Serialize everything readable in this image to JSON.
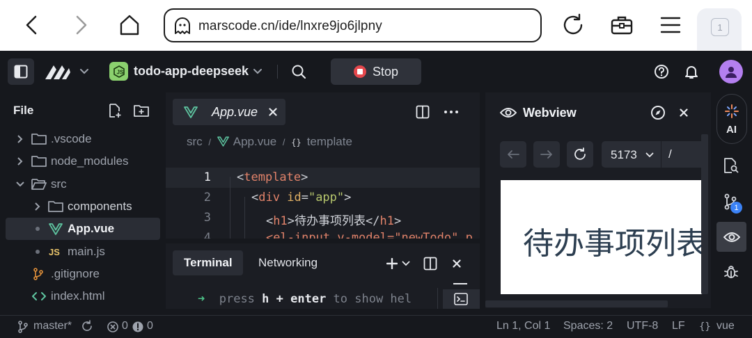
{
  "browser": {
    "url": "marscode.cn/ide/lnxre9jo6jlpny",
    "tab_count": "1"
  },
  "ide": {
    "project_name": "todo-app-deepseek",
    "stop_label": "Stop",
    "avatar_color": "#b47ff0",
    "accent_green": "#8bd16e"
  },
  "sidebar": {
    "title": "File",
    "items": [
      {
        "label": ".vscode"
      },
      {
        "label": "node_modules"
      },
      {
        "label": "src"
      },
      {
        "label": "components"
      },
      {
        "label": "App.vue"
      },
      {
        "label": "main.js"
      },
      {
        "label": ".gitignore"
      },
      {
        "label": "index.html"
      }
    ]
  },
  "editor": {
    "tab_label": "App.vue",
    "breadcrumb": {
      "part1": "src",
      "sep": "/",
      "part2": "App.vue",
      "part3": "template"
    },
    "line_numbers": [
      "1",
      "2",
      "3",
      "4"
    ],
    "lines": [
      {
        "lt": "<",
        "tag": "template",
        "gt": ">"
      },
      {
        "lt": "<",
        "tag": "div",
        "attr": "id",
        "eq": "=",
        "str": "\"app\"",
        "gt": ">"
      },
      {
        "lt": "<",
        "tag": "h1",
        "gt1": ">",
        "text": "待办事项列表",
        "lt2": "</",
        "tag2": "h1",
        "gt2": ">"
      },
      {
        "text": "<el-input v-model=\"newTodo\" p"
      }
    ]
  },
  "terminal": {
    "tab_terminal": "Terminal",
    "tab_networking": "Networking",
    "line": {
      "arrow": "➜",
      "p1": "press ",
      "h": "h",
      "p2": " + ",
      "enter": "enter",
      "p3": " to show hel"
    }
  },
  "webview": {
    "title": "Webview",
    "port": "5173",
    "path": "/",
    "page_heading": "待办事项列表"
  },
  "rightbar": {
    "ai_label": "AI",
    "git_badge": "1"
  },
  "statusbar": {
    "branch": "master*",
    "errors": "0",
    "warnings": "0",
    "position": "Ln 1, Col 1",
    "spaces": "Spaces: 2",
    "encoding": "UTF-8",
    "eol": "LF",
    "language": "vue"
  }
}
